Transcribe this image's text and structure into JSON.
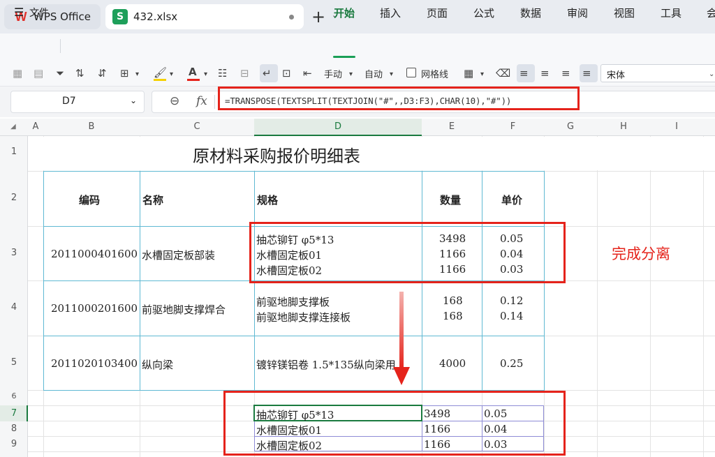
{
  "tabs": {
    "app_title": "WPS Office",
    "file_title": "432.xlsx"
  },
  "menu": {
    "file": "文件",
    "items": [
      "开始",
      "插入",
      "页面",
      "公式",
      "数据",
      "审阅",
      "视图",
      "工具",
      "会"
    ]
  },
  "toolbar": {
    "manual": "手动",
    "auto": "自动",
    "gridlines": "网格线",
    "font": "宋体"
  },
  "formula_bar": {
    "cell_ref": "D7",
    "fx": "fx",
    "formula": "=TRANSPOSE(TEXTSPLIT(TEXTJOIN(\"#\",,D3:F3),CHAR(10),\"#\"))"
  },
  "columns": [
    "A",
    "B",
    "C",
    "D",
    "E",
    "F",
    "G",
    "H",
    "I"
  ],
  "rows": [
    "1",
    "2",
    "3",
    "4",
    "5",
    "6",
    "7",
    "8",
    "9"
  ],
  "sheet": {
    "title": "原材料采购报价明细表",
    "headers": {
      "code": "编码",
      "name": "名称",
      "spec": "规格",
      "qty": "数量",
      "price": "单价"
    },
    "r3": {
      "code": "2011000401600",
      "name": "水槽固定板部装",
      "spec": [
        "抽芯铆钉  φ5*13",
        "水槽固定板01",
        "水槽固定板02"
      ],
      "qty": [
        "3498",
        "1166",
        "1166"
      ],
      "price": [
        "0.05",
        "0.04",
        "0.03"
      ]
    },
    "r4": {
      "code": "2011000201600",
      "name": "前驱地脚支撑焊合",
      "spec": [
        "前驱地脚支撑板",
        "前驱地脚支撑连接板"
      ],
      "qty": [
        "168",
        "168"
      ],
      "price": [
        "0.12",
        "0.14"
      ]
    },
    "r5": {
      "code": "2011020103400",
      "name": "纵向梁",
      "spec": "镀锌镁铝卷 1.5*135纵向梁用",
      "qty": "4000",
      "price": "0.25"
    },
    "result": [
      {
        "spec": "抽芯铆钉  φ5*13",
        "qty": "3498",
        "price": "0.05"
      },
      {
        "spec": "水槽固定板01",
        "qty": "1166",
        "price": "0.04"
      },
      {
        "spec": "水槽固定板02",
        "qty": "1166",
        "price": "0.03"
      }
    ]
  },
  "annotation": {
    "text": "完成分离",
    "color": "#e5231b"
  }
}
